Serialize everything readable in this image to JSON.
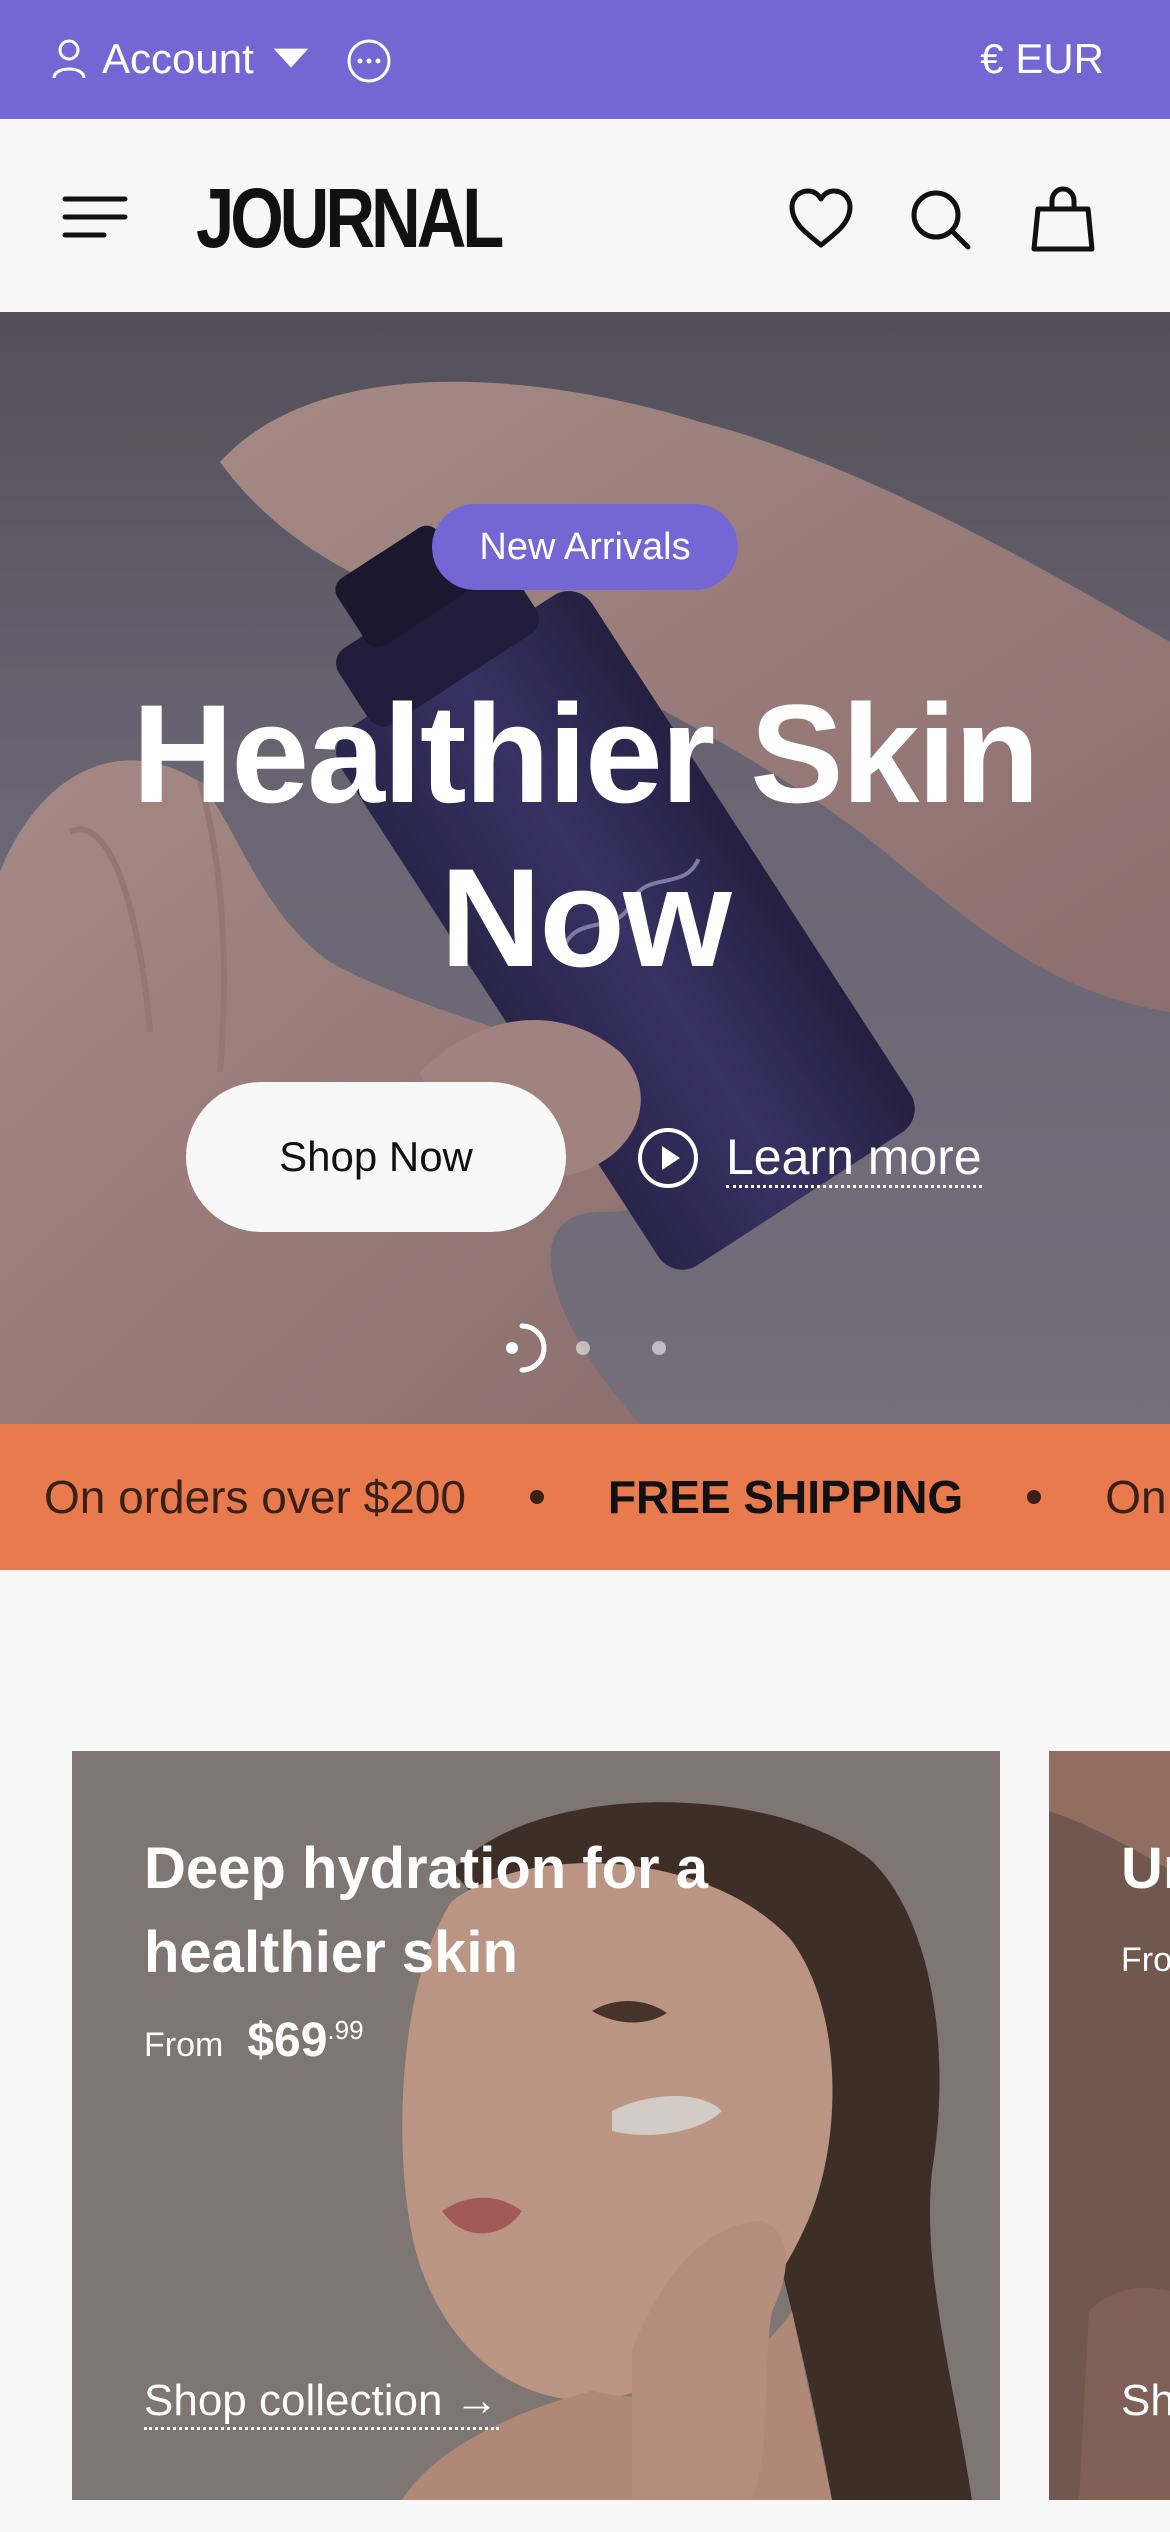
{
  "topbar": {
    "account_label": "Account",
    "currency_label": "€ EUR",
    "background": "#7567d3"
  },
  "header": {
    "logo": "JOURNAL"
  },
  "hero": {
    "badge": "New Arrivals",
    "title": "Healthier Skin Now",
    "primary_cta": "Shop Now",
    "secondary_cta": "Learn more",
    "slides_total": 3,
    "slide_active": 1
  },
  "promo_strip": {
    "items": [
      "On orders over $200",
      "FREE SHIPPING",
      "On c"
    ],
    "background": "#e97a4e"
  },
  "collections": [
    {
      "title": "Deep hydration for a healthier skin",
      "from_label": "From",
      "price_dollars": "$69",
      "price_cents": ".99",
      "cta": "Shop collection →"
    },
    {
      "title": "Ur",
      "from_label": "Fro",
      "cta": "Sh"
    }
  ],
  "icons": [
    "user-icon",
    "caret-down-icon",
    "more-icon",
    "hamburger-menu-icon",
    "heart-icon",
    "search-icon",
    "shopping-bag-icon",
    "play-circle-icon",
    "slide-progress-icon"
  ]
}
